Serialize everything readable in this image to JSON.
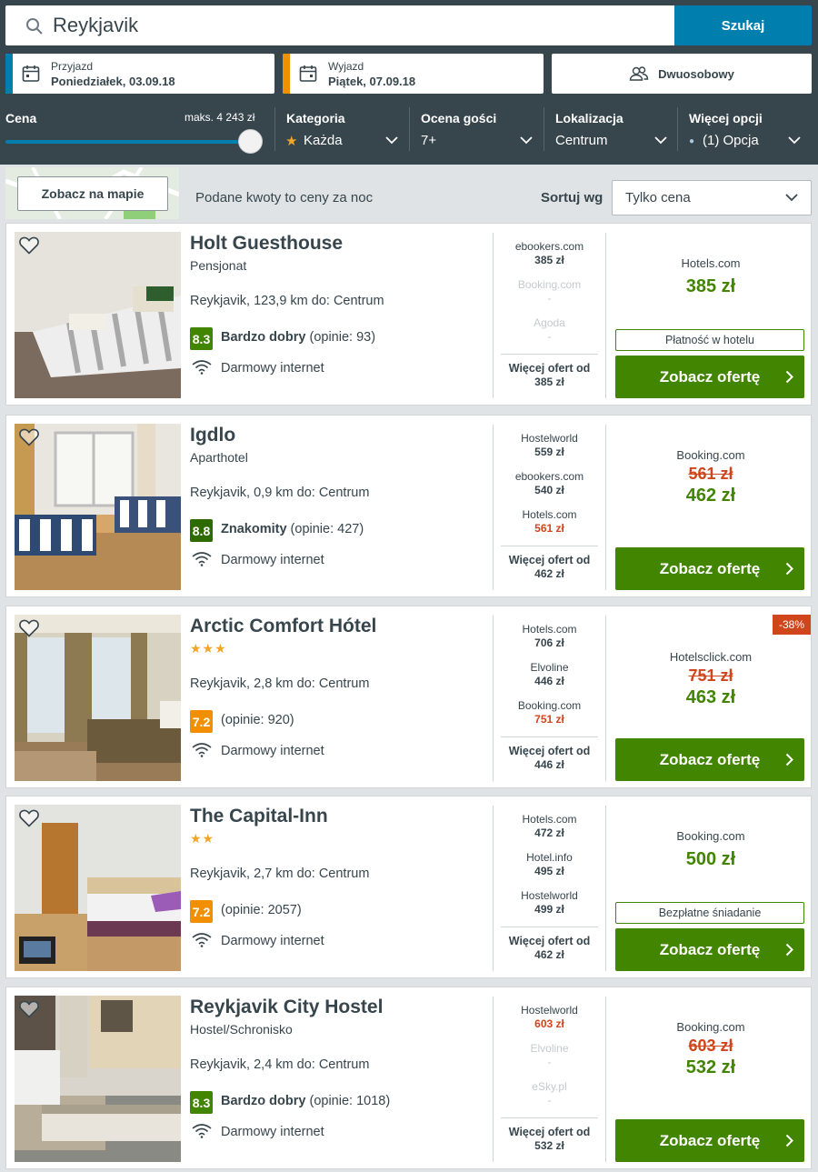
{
  "search": {
    "query": "Reykjavik",
    "button": "Szukaj"
  },
  "dates": {
    "checkin_label": "Przyjazd",
    "checkin_value": "Poniedziałek, 03.09.18",
    "checkout_label": "Wyjazd",
    "checkout_value": "Piątek, 07.09.18",
    "room": "Dwuosobowy"
  },
  "filters": {
    "price_label": "Cena",
    "price_max": "maks. 4 243 zł",
    "price_fraction": 1.0,
    "category_label": "Kategoria",
    "category_value": "Każda",
    "rating_label": "Ocena gości",
    "rating_value": "7+",
    "location_label": "Lokalizacja",
    "location_value": "Centrum",
    "more_label": "Więcej opcji",
    "more_value": "(1) Opcja"
  },
  "sortbar": {
    "map_button": "Zobacz na mapie",
    "price_note": "Podane kwoty to ceny za noc",
    "sort_label": "Sortuj wg",
    "sort_value": "Tylko cena"
  },
  "colors": {
    "header": "#37454d",
    "search_blue": "#007faf",
    "deal_green": "#428500",
    "price_red": "#d0451b",
    "rating_green": "#428500",
    "rating_orange": "#f18f00"
  },
  "hotels": [
    {
      "name": "Holt Guesthouse",
      "type": "Pensjonat",
      "stars": "",
      "location": "Reykjavik, 123,9 km do: Centrum",
      "rating": "8.3",
      "rating_word": "Bardzo dobry",
      "reviews": "(opinie: 93)",
      "wifi": "Darmowy internet",
      "offers": [
        {
          "site": "ebookers.com",
          "price": "385 zł"
        },
        {
          "site": "Booking.com",
          "price": "-"
        },
        {
          "site": "Agoda",
          "price": "-"
        }
      ],
      "more_label": "Więcej ofert od",
      "more_price": "385 zł",
      "provider": "Hotels.com",
      "old_price": "",
      "price": "385 zł",
      "perk": "Płatność w hotelu",
      "discount": "",
      "button": "Zobacz ofertę"
    },
    {
      "name": "Igdlo",
      "type": "Aparthotel",
      "stars": "",
      "location": "Reykjavik, 0,9 km do: Centrum",
      "rating": "8.8",
      "rating_word": "Znakomity",
      "reviews": "(opinie: 427)",
      "wifi": "Darmowy internet",
      "offers": [
        {
          "site": "Hostelworld",
          "price": "559 zł"
        },
        {
          "site": "ebookers.com",
          "price": "540 zł"
        },
        {
          "site": "Hotels.com",
          "price": "561 zł"
        }
      ],
      "more_label": "Więcej ofert od",
      "more_price": "462 zł",
      "provider": "Booking.com",
      "old_price": "561 zł",
      "price": "462 zł",
      "perk": "",
      "discount": "",
      "button": "Zobacz ofertę"
    },
    {
      "name": "Arctic Comfort Hótel",
      "type": "",
      "stars": "★★★",
      "location": "Reykjavik, 2,8 km do: Centrum",
      "rating": "7.2",
      "rating_word": "",
      "reviews": "(opinie: 920)",
      "wifi": "Darmowy internet",
      "offers": [
        {
          "site": "Hotels.com",
          "price": "706 zł"
        },
        {
          "site": "Elvoline",
          "price": "446 zł"
        },
        {
          "site": "Booking.com",
          "price": "751 zł"
        }
      ],
      "more_label": "Więcej ofert od",
      "more_price": "446 zł",
      "provider": "Hotelsclick.com",
      "old_price": "751 zł",
      "price": "463 zł",
      "perk": "",
      "discount": "-38%",
      "button": "Zobacz ofertę"
    },
    {
      "name": "The Capital-Inn",
      "type": "",
      "stars": "★★",
      "location": "Reykjavik, 2,7 km do: Centrum",
      "rating": "7.2",
      "rating_word": "",
      "reviews": "(opinie: 2057)",
      "wifi": "Darmowy internet",
      "offers": [
        {
          "site": "Hotels.com",
          "price": "472 zł"
        },
        {
          "site": "Hotel.info",
          "price": "495 zł"
        },
        {
          "site": "Hostelworld",
          "price": "499 zł"
        }
      ],
      "more_label": "Więcej ofert od",
      "more_price": "462 zł",
      "provider": "Booking.com",
      "old_price": "",
      "price": "500 zł",
      "perk": "Bezpłatne śniadanie",
      "discount": "",
      "button": "Zobacz ofertę"
    },
    {
      "name": "Reykjavik City Hostel",
      "type": "Hostel/Schronisko",
      "stars": "",
      "location": "Reykjavik, 2,4 km do: Centrum",
      "rating": "8.3",
      "rating_word": "Bardzo dobry",
      "reviews": "(opinie: 1018)",
      "wifi": "Darmowy internet",
      "offers": [
        {
          "site": "Hostelworld",
          "price": "603 zł"
        },
        {
          "site": "Elvoline",
          "price": "-"
        },
        {
          "site": "eSky.pl",
          "price": "-"
        }
      ],
      "more_label": "Więcej ofert od",
      "more_price": "532 zł",
      "provider": "Booking.com",
      "old_price": "603 zł",
      "price": "532 zł",
      "perk": "",
      "discount": "",
      "button": "Zobacz ofertę"
    }
  ]
}
